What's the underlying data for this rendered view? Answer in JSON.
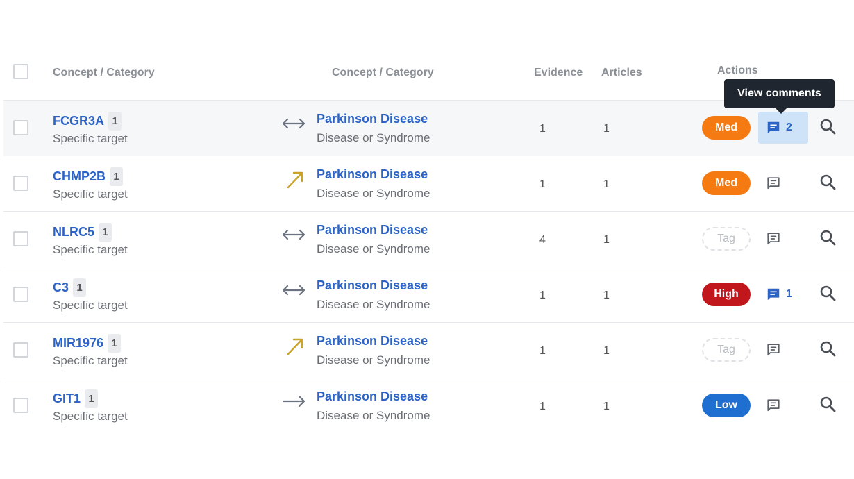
{
  "header": {
    "concept_a": "Concept / Category",
    "concept_b": "Concept / Category",
    "evidence": "Evidence",
    "articles": "Articles",
    "actions": "Actions"
  },
  "tooltip": "View comments",
  "rows": [
    {
      "name": "FCGR3A",
      "count": "1",
      "category": "Specific target",
      "relation": "bidirectional-arrow-icon",
      "target": "Parkinson Disease",
      "target_category": "Disease or Syndrome",
      "evidence": "1",
      "articles": "1",
      "level": "Med",
      "level_kind": "med",
      "comments": "2"
    },
    {
      "name": "CHMP2B",
      "count": "1",
      "category": "Specific target",
      "relation": "up-right-arrow-icon",
      "target": "Parkinson Disease",
      "target_category": "Disease or Syndrome",
      "evidence": "1",
      "articles": "1",
      "level": "Med",
      "level_kind": "med",
      "comments": ""
    },
    {
      "name": "NLRC5",
      "count": "1",
      "category": "Specific target",
      "relation": "bidirectional-arrow-icon",
      "target": "Parkinson Disease",
      "target_category": "Disease or Syndrome",
      "evidence": "4",
      "articles": "1",
      "level": "Tag",
      "level_kind": "tag",
      "comments": ""
    },
    {
      "name": "C3",
      "count": "1",
      "category": "Specific target",
      "relation": "bidirectional-arrow-icon",
      "target": "Parkinson Disease",
      "target_category": "Disease or Syndrome",
      "evidence": "1",
      "articles": "1",
      "level": "High",
      "level_kind": "high",
      "comments": "1"
    },
    {
      "name": "MIR1976",
      "count": "1",
      "category": "Specific target",
      "relation": "up-right-arrow-icon",
      "target": "Parkinson Disease",
      "target_category": "Disease or Syndrome",
      "evidence": "1",
      "articles": "1",
      "level": "Tag",
      "level_kind": "tag",
      "comments": ""
    },
    {
      "name": "GIT1",
      "count": "1",
      "category": "Specific target",
      "relation": "right-arrow-icon",
      "target": "Parkinson Disease",
      "target_category": "Disease or Syndrome",
      "evidence": "1",
      "articles": "1",
      "level": "Low",
      "level_kind": "low",
      "comments": ""
    }
  ],
  "colors": {
    "link": "#2b63c6",
    "med": "#f57a12",
    "high": "#c0161c",
    "low": "#1f6fd0",
    "up_arrow": "#c9a227",
    "neutral_arrow": "#6b7380"
  }
}
